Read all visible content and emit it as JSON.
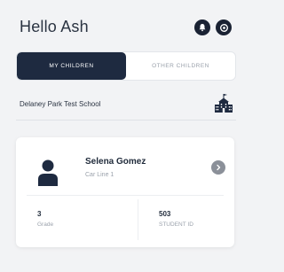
{
  "header": {
    "greeting": "Hello Ash",
    "icons": [
      "notification-icon",
      "settings-icon"
    ]
  },
  "tabs": [
    {
      "label": "MY CHILDREN",
      "active": true
    },
    {
      "label": "OTHER CHILDREN",
      "active": false
    }
  ],
  "school": {
    "name": "Delaney Park Test School",
    "icon": "school-building-icon"
  },
  "child_card": {
    "name": "Selena Gomez",
    "subtitle": "Car Line 1",
    "grade_value": "3",
    "grade_label": "Grade",
    "student_id_value": "503",
    "student_id_label": "STUDENT ID"
  },
  "colors": {
    "primary": "#1e2a40",
    "background": "#f2f3f5",
    "muted_text": "#9aa1ab"
  }
}
